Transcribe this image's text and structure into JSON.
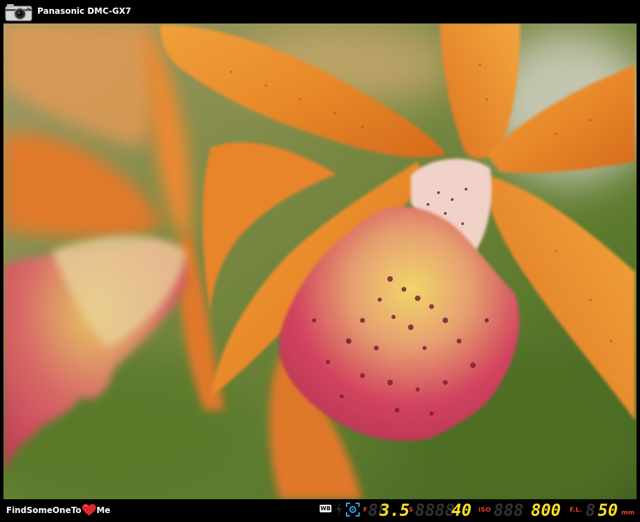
{
  "header": {
    "camera_model": "Panasonic DMC-GX7",
    "camera_icon": "camera-icon"
  },
  "photo": {
    "subject": "orange-orchid-photo",
    "colors": {
      "background_green": "#6b7f3a",
      "petal_orange": "#e8892a",
      "lip_pink": "#d2445e",
      "throat_yellow": "#f1d56a",
      "spot_purple": "#7a1f3d"
    }
  },
  "footer": {
    "brand_left": "FindSomeOneTo",
    "brand_right": "Me",
    "heart_icon": "heart-icon",
    "wb_label": "WB",
    "flash_icon": "flash-icon",
    "metering_icon": "metering-icon",
    "aperture_label": "F",
    "aperture_ghost": "88",
    "aperture_value": "3.5",
    "shutter_label": "S",
    "shutter_ghost": "8888",
    "shutter_value": "40",
    "iso_label": "ISO",
    "iso_ghost": "888",
    "iso_value": "800",
    "fl_label": "F.L.",
    "fl_ghost": "8",
    "fl_value": "50",
    "fl_unit": "mm",
    "value_color": "#ffe31a",
    "label_color": "#f0432a"
  }
}
